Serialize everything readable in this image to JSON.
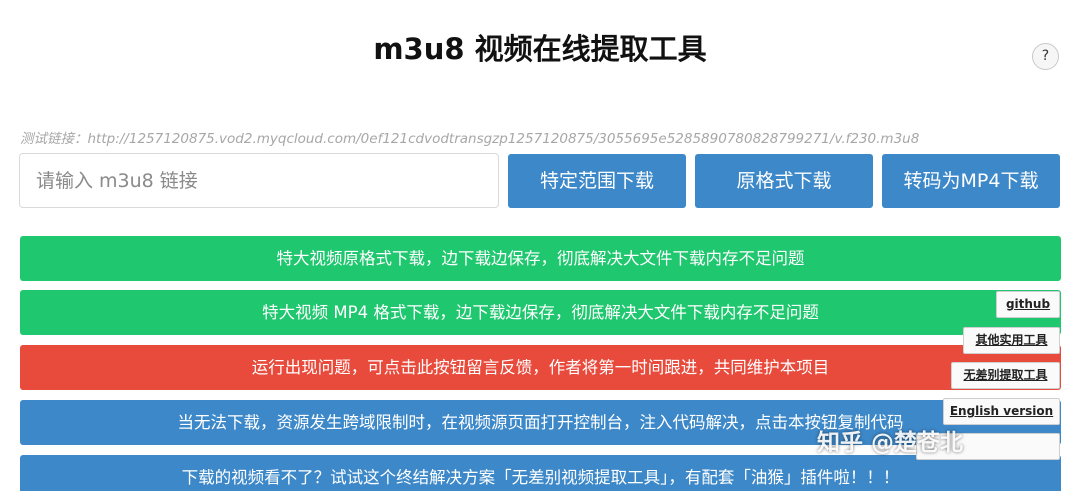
{
  "title": "m3u8 视频在线提取工具",
  "help_label": "?",
  "example_text": "测试链接：http://1257120875.vod2.myqcloud.com/0ef121cdvodtransgzp1257120875/3055695e5285890780828799271/v.f230.m3u8",
  "input": {
    "placeholder": "请输入 m3u8 链接",
    "value": ""
  },
  "buttons": {
    "range_download": "特定范围下载",
    "original_download": "原格式下载",
    "mp4_download": "转码为MP4下载"
  },
  "bars": [
    {
      "label": "特大视频原格式下载，边下载边保存，彻底解决大文件下载内存不足问题",
      "color": "#1fc76f"
    },
    {
      "label": "特大视频 MP4 格式下载，边下载边保存，彻底解决大文件下载内存不足问题",
      "color": "#1fc76f"
    },
    {
      "label": "运行出现问题，可点击此按钮留言反馈，作者将第一时间跟进，共同维护本项目",
      "color": "#e84a3c"
    },
    {
      "label": "当无法下载，资源发生跨域限制时，在视频源页面打开控制台，注入代码解决，点击本按钮复制代码",
      "color": "#3d88c9"
    },
    {
      "label": "下载的视频看不了？试试这个终结解决方案「无差别视频提取工具」，有配套「油猴」插件啦！！！",
      "color": "#3d88c9"
    }
  ],
  "side_links": {
    "github": "github",
    "other_tools": "其他实用工具",
    "no_diff_extract": "无差别提取工具",
    "english": "English version",
    "fifth": ""
  },
  "watermark": "知乎 @楚苍北",
  "colors": {
    "accent_blue": "#3d88c9",
    "green": "#1fc76f",
    "red": "#e84a3c"
  }
}
